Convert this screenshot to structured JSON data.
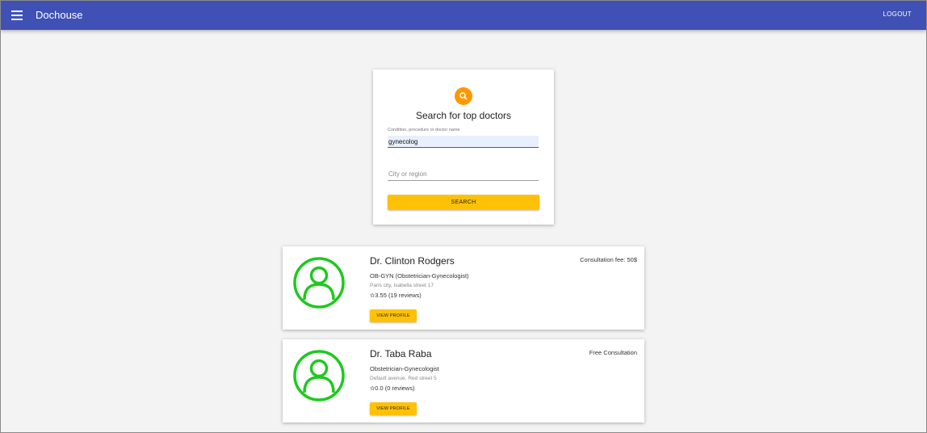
{
  "appbar": {
    "title": "Dochouse",
    "logout_label": "LOGOUT",
    "color": "#3f51b5"
  },
  "search": {
    "title": "Search for top doctors",
    "condition_label": "Condition, procedure or doctor name",
    "condition_value": "gynecolog",
    "city_placeholder": "City or region",
    "button_label": "SEARCH",
    "icon": "search-icon",
    "accent": "#ff9800"
  },
  "doctors": [
    {
      "name": "Dr. Clinton Rodgers",
      "specialty": "OB-GYN (Obstetrician-Gynecologist)",
      "address": "Paris city, Isabella street 17",
      "rating": "✫3.55 (19 reviews)",
      "fee": "Consultation fee: 50$",
      "button_label": "VIEW PROFILE"
    },
    {
      "name": "Dr. Taba Raba",
      "specialty": "Obstetrician-Gynecologist",
      "address": "Default avenue, Red street 5",
      "rating": "✫0.0 (0 reviews)",
      "fee": "Free Consultation",
      "button_label": "VIEW PROFILE"
    }
  ],
  "colors": {
    "button": "#ffc107",
    "avatar_outline": "#1ec91e"
  }
}
